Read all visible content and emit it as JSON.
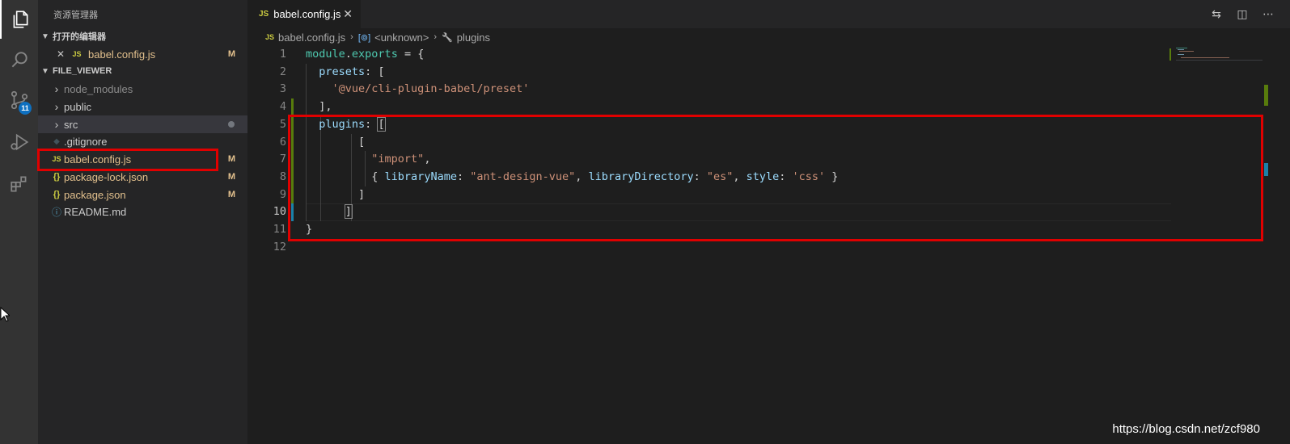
{
  "sidebar": {
    "title": "资源管理器",
    "open_editors": {
      "header": "打开的编辑器",
      "items": [
        {
          "close": "✕",
          "icon": "JS",
          "name": "babel.config.js",
          "status": "M"
        }
      ]
    },
    "project": {
      "header": "FILE_VIEWER",
      "items": [
        {
          "icon": "›",
          "name": "node_modules",
          "status": ""
        },
        {
          "icon": "›",
          "name": "public",
          "status": ""
        },
        {
          "icon": "›",
          "name": "src",
          "status": ""
        },
        {
          "icon": "◆",
          "name": ".gitignore",
          "status": ""
        },
        {
          "icon": "JS",
          "name": "babel.config.js",
          "status": "M"
        },
        {
          "icon": "{}",
          "name": "package-lock.json",
          "status": "M"
        },
        {
          "icon": "{}",
          "name": "package.json",
          "status": "M"
        },
        {
          "icon": "ⓘ",
          "name": "README.md",
          "status": ""
        }
      ]
    }
  },
  "activity": {
    "scm_badge": "11"
  },
  "tab": {
    "icon": "JS",
    "label": "babel.config.js",
    "close": "✕"
  },
  "breadcrumb": {
    "file_icon": "JS",
    "file": "babel.config.js",
    "sep1": "›",
    "symbol_icon": "[⊚]",
    "symbol": "<unknown>",
    "sep2": "›",
    "prop_icon": "🔧",
    "prop": "plugins"
  },
  "editor": {
    "line_numbers": [
      "1",
      "2",
      "3",
      "4",
      "5",
      "6",
      "7",
      "8",
      "9",
      "10",
      "11",
      "12"
    ],
    "lines": [
      [
        {
          "c": "tk-var",
          "t": "module"
        },
        {
          "c": "tk-punc",
          "t": "."
        },
        {
          "c": "tk-var",
          "t": "exports"
        },
        {
          "c": "tk-punc",
          "t": " = {"
        }
      ],
      [
        {
          "c": "tk-punc",
          "t": "  "
        },
        {
          "c": "tk-prop",
          "t": "presets"
        },
        {
          "c": "tk-punc",
          "t": ": ["
        }
      ],
      [
        {
          "c": "tk-punc",
          "t": "    "
        },
        {
          "c": "tk-str",
          "t": "'@vue/cli-plugin-babel/preset'"
        }
      ],
      [
        {
          "c": "tk-punc",
          "t": "  ],"
        }
      ],
      [
        {
          "c": "tk-punc",
          "t": "  "
        },
        {
          "c": "tk-prop",
          "t": "plugins"
        },
        {
          "c": "tk-punc",
          "t": ": "
        },
        {
          "c": "tk-punc bracket-box",
          "t": "["
        }
      ],
      [
        {
          "c": "tk-punc",
          "t": "        ["
        }
      ],
      [
        {
          "c": "tk-punc",
          "t": "          "
        },
        {
          "c": "tk-str",
          "t": "\"import\""
        },
        {
          "c": "tk-punc",
          "t": ","
        }
      ],
      [
        {
          "c": "tk-punc",
          "t": "          { "
        },
        {
          "c": "tk-prop",
          "t": "libraryName"
        },
        {
          "c": "tk-punc",
          "t": ": "
        },
        {
          "c": "tk-str",
          "t": "\"ant-design-vue\""
        },
        {
          "c": "tk-punc",
          "t": ", "
        },
        {
          "c": "tk-prop",
          "t": "libraryDirectory"
        },
        {
          "c": "tk-punc",
          "t": ": "
        },
        {
          "c": "tk-str",
          "t": "\"es\""
        },
        {
          "c": "tk-punc",
          "t": ", "
        },
        {
          "c": "tk-prop",
          "t": "style"
        },
        {
          "c": "tk-punc",
          "t": ": "
        },
        {
          "c": "tk-str",
          "t": "'css'"
        },
        {
          "c": "tk-punc",
          "t": " }"
        }
      ],
      [
        {
          "c": "tk-punc",
          "t": "        ]"
        }
      ],
      [
        {
          "c": "tk-punc",
          "t": "      "
        },
        {
          "c": "tk-punc bracket-box",
          "t": "]"
        }
      ],
      [
        {
          "c": "tk-punc",
          "t": "}"
        }
      ],
      []
    ]
  },
  "watermark": "https://blog.csdn.net/zcf980"
}
